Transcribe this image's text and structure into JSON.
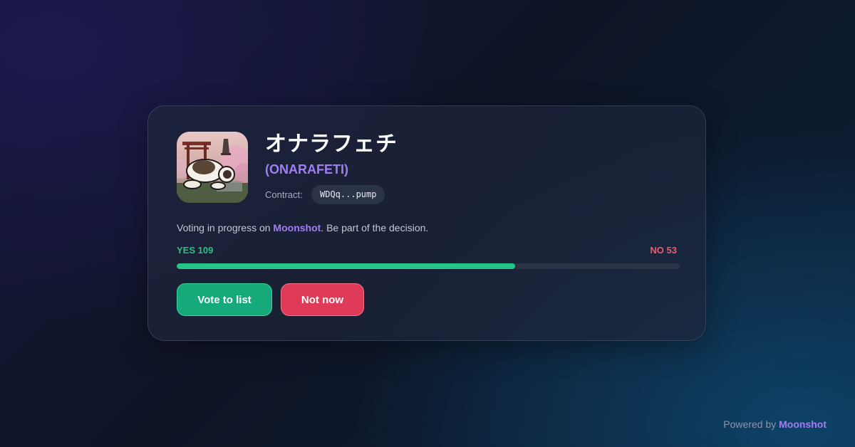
{
  "token": {
    "name": "オナラフェチ",
    "ticker": "(ONARAFETI)",
    "contract_label": "Contract:",
    "contract_value": "WDQq...pump",
    "image_icon": "token-image"
  },
  "description": {
    "prefix": "Voting in progress on ",
    "brand": "Moonshot",
    "suffix": ". Be part of the decision."
  },
  "votes": {
    "yes_label": "YES 109",
    "no_label": "NO 53",
    "yes": 109,
    "no": 53,
    "yes_fraction": 0.673
  },
  "buttons": {
    "vote_label": "Vote to list",
    "decline_label": "Not now"
  },
  "footer": {
    "prefix": "Powered by ",
    "brand": "Moonshot"
  },
  "colors": {
    "accent": "#a07ef5",
    "yes": "#25c487",
    "no": "#df3a57"
  }
}
